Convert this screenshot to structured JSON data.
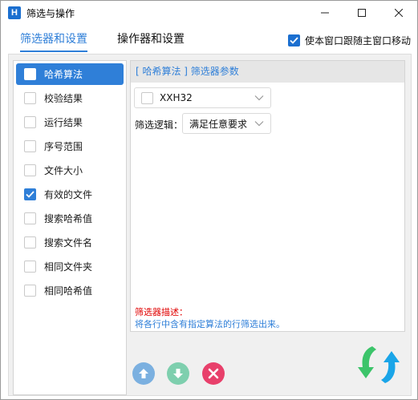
{
  "window": {
    "title": "筛选与操作",
    "app_icon_letter": "H",
    "controls": [
      "minimize-icon",
      "maximize-icon",
      "close-icon"
    ]
  },
  "tabs": [
    {
      "label": "筛选器和设置",
      "active": true
    },
    {
      "label": "操作器和设置",
      "active": false
    }
  ],
  "follow_main_window": {
    "label": "使本窗口跟随主窗口移动",
    "checked": true
  },
  "filters": [
    {
      "label": "哈希算法",
      "checked": false,
      "selected": true
    },
    {
      "label": "校验结果",
      "checked": false,
      "selected": false
    },
    {
      "label": "运行结果",
      "checked": false,
      "selected": false
    },
    {
      "label": "序号范围",
      "checked": false,
      "selected": false
    },
    {
      "label": "文件大小",
      "checked": false,
      "selected": false
    },
    {
      "label": "有效的文件",
      "checked": true,
      "selected": false
    },
    {
      "label": "搜索哈希值",
      "checked": false,
      "selected": false
    },
    {
      "label": "搜索文件名",
      "checked": false,
      "selected": false
    },
    {
      "label": "相同文件夹",
      "checked": false,
      "selected": false
    },
    {
      "label": "相同哈希值",
      "checked": false,
      "selected": false
    }
  ],
  "params": {
    "header": "[ 哈希算法 ] 筛选器参数",
    "algorithm_combo": {
      "value": "XXH32",
      "checked": false
    },
    "logic_label": "筛选逻辑：",
    "logic_combo": {
      "value": "满足任意要求"
    }
  },
  "description": {
    "title": "筛选器描述：",
    "text": "将各行中含有指定算法的行筛选出来。"
  },
  "buttons": {
    "move_up": "arrow-up-icon",
    "move_down": "arrow-down-icon",
    "delete": "close-icon",
    "apply": "refresh-arrows-icon"
  },
  "colors": {
    "accent": "#2f7fd8",
    "description_title": "#e00000",
    "move_up": "#7bb0e0",
    "move_down": "#7ecfae",
    "delete": "#e8406b"
  }
}
